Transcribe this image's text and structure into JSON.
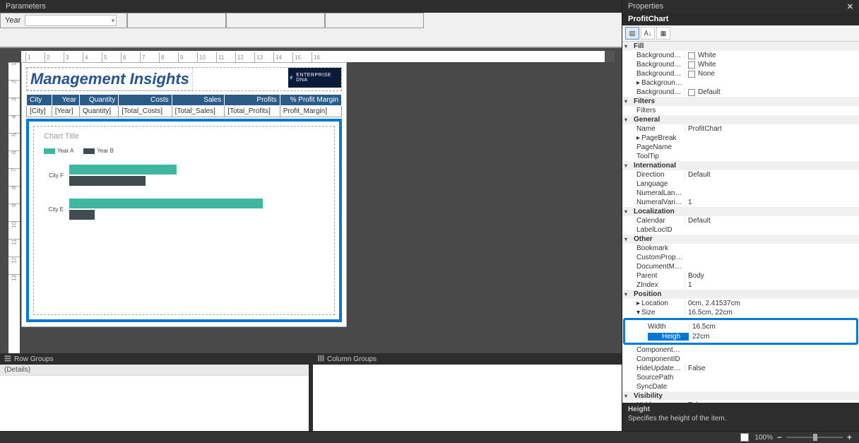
{
  "parameters": {
    "header": "Parameters",
    "label": "Year"
  },
  "ruler_h": [
    "1",
    "2",
    "3",
    "4",
    "5",
    "6",
    "7",
    "8",
    "9",
    "10",
    "11",
    "12",
    "13",
    "14",
    "15",
    "16"
  ],
  "ruler_v": [
    "1",
    "2",
    "3",
    "4",
    "5",
    "6",
    "7",
    "8",
    "9",
    "10",
    "11",
    "12",
    "13"
  ],
  "report": {
    "title": "Management Insights",
    "logo_text": "ENTERPRISE DNA",
    "columns": [
      "City",
      "Year",
      "Quantity",
      "Costs",
      "Sales",
      "Profits",
      "% Profit Margin"
    ],
    "fields": [
      "[City]",
      "[Year]",
      "Quantity]",
      "[Total_Costs]",
      "[Total_Sales]",
      "[Total_Profits]",
      "Profit_Margin]"
    ]
  },
  "chart_data": {
    "type": "bar",
    "title": "Chart Title",
    "legend": [
      "Year A",
      "Year B"
    ],
    "categories": [
      "City F",
      "City E"
    ],
    "series": [
      {
        "name": "Year A",
        "values": [
          42,
          76
        ]
      },
      {
        "name": "Year B",
        "values": [
          30,
          10
        ]
      }
    ],
    "xlim": [
      0,
      100
    ]
  },
  "groups": {
    "row_header": "Row Groups",
    "col_header": "Column Groups",
    "detail": "(Details)"
  },
  "properties": {
    "header": "Properties",
    "object": "ProfitChart",
    "desc_title": "Height",
    "desc_text": "Specifies the height of the item.",
    "cats": {
      "fill": "Fill",
      "filters": "Filters",
      "general": "General",
      "intl": "International",
      "local": "Localization",
      "other": "Other",
      "position": "Position",
      "visibility": "Visibility"
    },
    "rows": {
      "bgcolor": {
        "n": "BackgroundColor",
        "v": "White"
      },
      "bggrad1": {
        "n": "BackgroundGradientEndColor",
        "v": "White"
      },
      "bggrad2": {
        "n": "BackgroundGradientType",
        "v": "None"
      },
      "bgimage": {
        "n": "BackgroundImage",
        "v": ""
      },
      "bgpattern": {
        "n": "BackgroundHatchType",
        "v": "Default"
      },
      "filters": {
        "n": "Filters",
        "v": ""
      },
      "name": {
        "n": "Name",
        "v": "ProfitChart"
      },
      "pagebreak": {
        "n": "PageBreak",
        "v": ""
      },
      "pagename": {
        "n": "PageName",
        "v": ""
      },
      "tooltip": {
        "n": "ToolTip",
        "v": ""
      },
      "direction": {
        "n": "Direction",
        "v": "Default"
      },
      "language": {
        "n": "Language",
        "v": ""
      },
      "numlang": {
        "n": "NumeralLanguage",
        "v": ""
      },
      "numvar": {
        "n": "NumeralVariant",
        "v": "1"
      },
      "calendar": {
        "n": "Calendar",
        "v": "Default"
      },
      "labelloc": {
        "n": "LabelLocID",
        "v": ""
      },
      "bookmark": {
        "n": "Bookmark",
        "v": ""
      },
      "customprops": {
        "n": "CustomProperties",
        "v": ""
      },
      "docmap": {
        "n": "DocumentMapLabel",
        "v": ""
      },
      "parent": {
        "n": "Parent",
        "v": "Body"
      },
      "zindex": {
        "n": "ZIndex",
        "v": "1"
      },
      "location": {
        "n": "Location",
        "v": "0cm, 2.41537cm"
      },
      "size": {
        "n": "Size",
        "v": "16.5cm, 22cm"
      },
      "width": {
        "n": "Width",
        "v": "16.5cm"
      },
      "height": {
        "n": "Height",
        "v": "22cm"
      },
      "compdesc": {
        "n": "ComponentDescription",
        "v": ""
      },
      "compid": {
        "n": "ComponentID",
        "v": ""
      },
      "hideupdate": {
        "n": "HideUpdateNotification",
        "v": "False"
      },
      "sourcepath": {
        "n": "SourcePath",
        "v": ""
      },
      "syncdate": {
        "n": "SyncDate",
        "v": ""
      },
      "hidden": {
        "n": "Hidden",
        "v": "False"
      }
    }
  },
  "zoom": {
    "value": "100%",
    "minus": "−",
    "plus": "+"
  }
}
